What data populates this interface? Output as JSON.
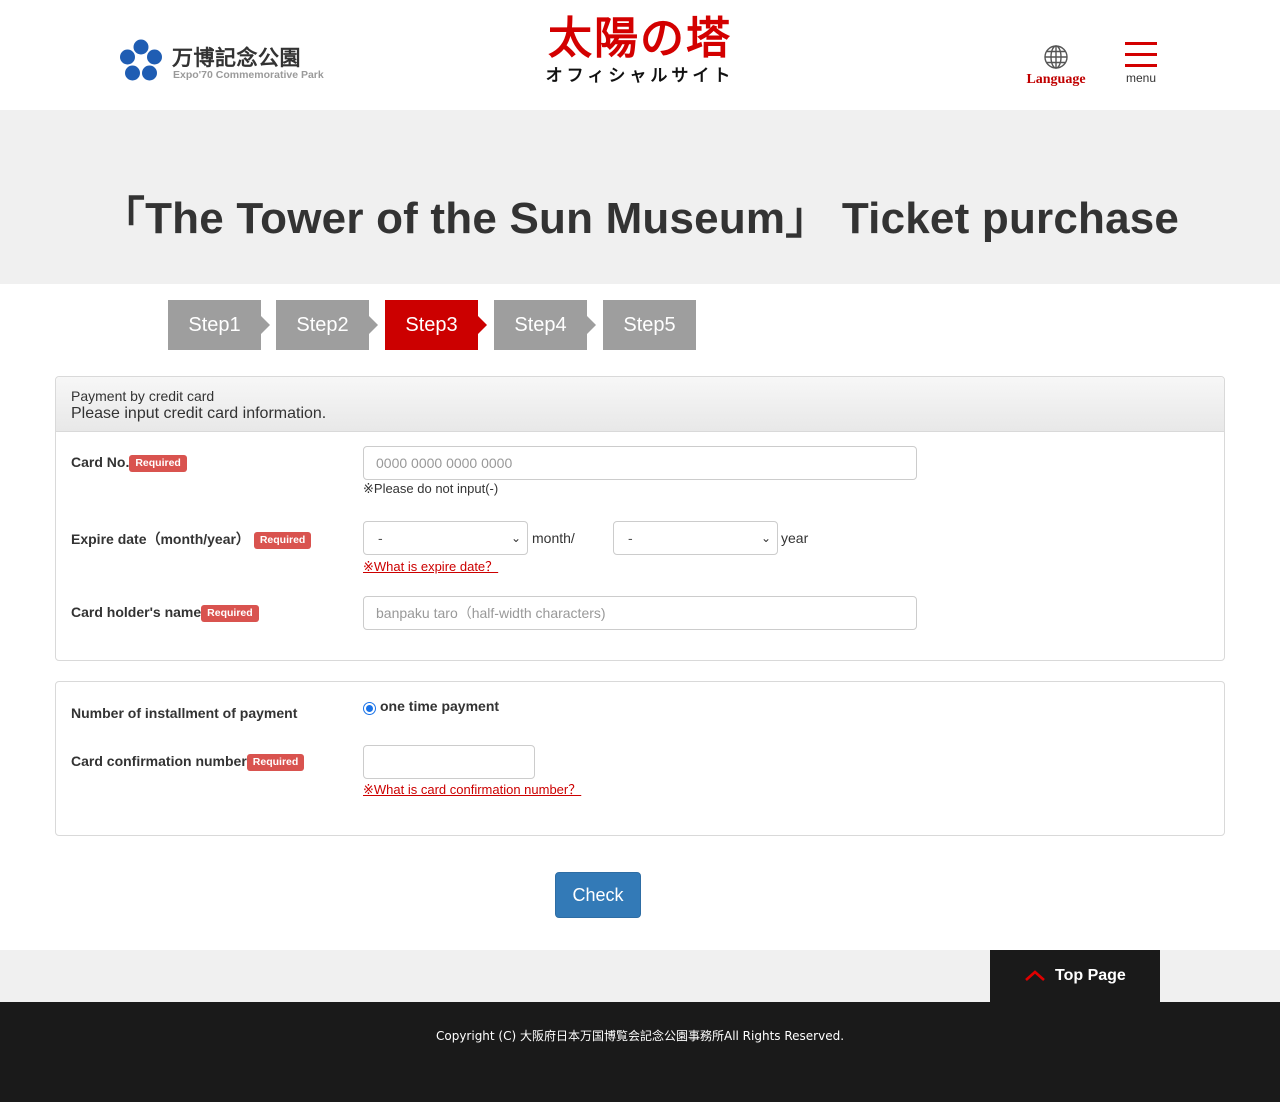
{
  "header": {
    "park_logo_jp": "万博記念公園",
    "park_logo_en": "Expo'70 Commemorative Park",
    "site_title": "太陽の塔",
    "site_subtitle": "オフィシャルサイト",
    "language_label": "Language",
    "menu_label": "menu"
  },
  "page_title": "「The Tower of the Sun Museum」 Ticket purchase",
  "steps": [
    "Step1",
    "Step2",
    "Step3",
    "Step4",
    "Step5"
  ],
  "active_step": "Step3",
  "card_panel": {
    "heading_small": "Payment by credit card",
    "heading_main": "Please input credit card information.",
    "required_badge": "Required",
    "card_no_label": "Card No.",
    "card_no_placeholder": "0000 0000 0000 0000",
    "card_no_note": "※Please do not input(-)",
    "expire_label": "Expire date（month/year）",
    "month_selected": "-",
    "month_unit": "month/",
    "year_selected": "-",
    "year_unit": "year",
    "expire_help_link": "※What is expire date？",
    "holder_label": "Card holder's name",
    "holder_placeholder": "banpaku taro（half-width characters)"
  },
  "payment_panel": {
    "installment_label": "Number of installment of payment",
    "installment_option": "one time payment",
    "confirmation_label": "Card confirmation number",
    "confirmation_value": "",
    "confirmation_help_link": "※What is card confirmation number？"
  },
  "check_button": "Check",
  "top_page_label": "Top Page",
  "footer_copyright": "Copyright (C) 大阪府日本万国博覧会記念公園事務所All Rights Reserved.",
  "colors": {
    "brand_red": "#d30000",
    "primary_blue": "#337ab7",
    "badge_red": "#d9534f",
    "step_gray": "#9e9e9e",
    "footer_dark": "#1a1a1a"
  }
}
